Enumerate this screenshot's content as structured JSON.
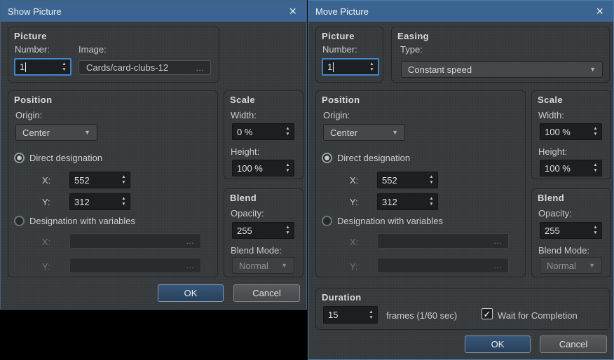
{
  "icons": {
    "close": "×",
    "spin_up": "▲",
    "spin_down": "▼",
    "dropdown_arrow": "▼",
    "check": "✓",
    "ellipsis": "…"
  },
  "colors": {
    "titlebar": "#3b6590",
    "focus_border": "#4286c8",
    "active_window_border": "#4a7aad",
    "inactive_window_border": "#44607c",
    "ok_button": "#2f4d6f",
    "dialog_background": "#3a3d3f"
  },
  "left_dialog": {
    "title": "Show Picture",
    "picture": {
      "title": "Picture",
      "number_label": "Number:",
      "number_value": "1",
      "image_label": "Image:",
      "image_value": "Cards/card-clubs-12"
    },
    "position": {
      "title": "Position",
      "origin_label": "Origin:",
      "origin_value": "Center",
      "direct_label": "Direct designation",
      "x_label": "X:",
      "x_value": "552",
      "y_label": "Y:",
      "y_value": "312",
      "variables_label": "Designation with variables",
      "var_x_label": "X:",
      "var_x_value": "",
      "var_y_label": "Y:",
      "var_y_value": ""
    },
    "scale": {
      "title": "Scale",
      "width_label": "Width:",
      "width_value": "0 %",
      "height_label": "Height:",
      "height_value": "100 %"
    },
    "blend": {
      "title": "Blend",
      "opacity_label": "Opacity:",
      "opacity_value": "255",
      "mode_label": "Blend Mode:",
      "mode_value": "Normal"
    },
    "ok_label": "OK",
    "cancel_label": "Cancel"
  },
  "right_dialog": {
    "title": "Move Picture",
    "picture": {
      "title": "Picture",
      "number_label": "Number:",
      "number_value": "1"
    },
    "easing": {
      "title": "Easing",
      "type_label": "Type:",
      "type_value": "Constant speed"
    },
    "position": {
      "title": "Position",
      "origin_label": "Origin:",
      "origin_value": "Center",
      "direct_label": "Direct designation",
      "x_label": "X:",
      "x_value": "552",
      "y_label": "Y:",
      "y_value": "312",
      "variables_label": "Designation with variables",
      "var_x_label": "X:",
      "var_x_value": "",
      "var_y_label": "Y:",
      "var_y_value": ""
    },
    "scale": {
      "title": "Scale",
      "width_label": "Width:",
      "width_value": "100 %",
      "height_label": "Height:",
      "height_value": "100 %"
    },
    "blend": {
      "title": "Blend",
      "opacity_label": "Opacity:",
      "opacity_value": "255",
      "mode_label": "Blend Mode:",
      "mode_value": "Normal"
    },
    "duration": {
      "title": "Duration",
      "value": "15",
      "frames_label": "frames (1/60 sec)",
      "wait_label": "Wait for Completion",
      "wait_checked": true
    },
    "ok_label": "OK",
    "cancel_label": "Cancel"
  }
}
